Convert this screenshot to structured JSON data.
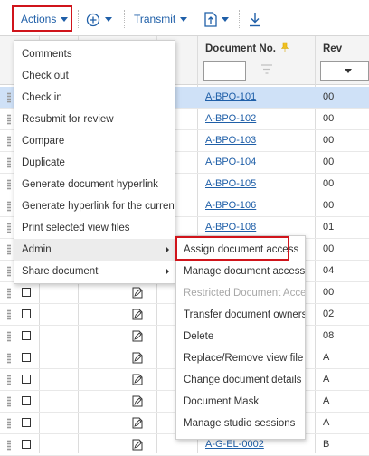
{
  "toolbar": {
    "actions_label": "Actions",
    "transmit_label": "Transmit"
  },
  "columns": {
    "document_no": "Document No.",
    "rev": "Rev"
  },
  "rows": [
    {
      "doc": "A-BPO-101",
      "rev": "00",
      "selected": true
    },
    {
      "doc": "A-BPO-102",
      "rev": "00"
    },
    {
      "doc": "A-BPO-103",
      "rev": "00"
    },
    {
      "doc": "A-BPO-104",
      "rev": "00"
    },
    {
      "doc": "A-BPO-105",
      "rev": "00"
    },
    {
      "doc": "A-BPO-106",
      "rev": "00"
    },
    {
      "doc": "A-BPO-108",
      "rev": "01"
    },
    {
      "doc": "",
      "rev": "00"
    },
    {
      "doc": "",
      "rev": "04"
    },
    {
      "doc": "",
      "rev": "00"
    },
    {
      "doc": "",
      "rev": "02"
    },
    {
      "doc": "",
      "rev": "08"
    },
    {
      "doc": "",
      "rev": "A"
    },
    {
      "doc": "",
      "rev": "A"
    },
    {
      "doc": "",
      "rev": "A"
    },
    {
      "doc": "",
      "rev": "A"
    },
    {
      "doc": "A-G-EL-0002",
      "rev": "B"
    }
  ],
  "actions_menu": [
    "Comments",
    "Check out",
    "Check in",
    "Resubmit for review",
    "Compare",
    "Duplicate",
    "Generate document hyperlink",
    "Generate hyperlink for the current r...",
    "Print selected view files",
    "Admin",
    "Share document"
  ],
  "admin_submenu": [
    {
      "label": "Assign document access",
      "disabled": false
    },
    {
      "label": "Manage document access",
      "disabled": false
    },
    {
      "label": "Restricted Document Access",
      "disabled": true
    },
    {
      "label": "Transfer document ownership",
      "disabled": false
    },
    {
      "label": "Delete",
      "disabled": false
    },
    {
      "label": "Replace/Remove view file",
      "disabled": false
    },
    {
      "label": "Change document details",
      "disabled": false
    },
    {
      "label": "Document Mask",
      "disabled": false
    },
    {
      "label": "Manage studio sessions",
      "disabled": false
    }
  ],
  "colors": {
    "link": "#1f5fa8",
    "highlight_box": "#d0141b",
    "selected_row": "#cfe1f7"
  },
  "icons": [
    "caret-down-icon",
    "add-circle-icon",
    "transmit-icon",
    "export-icon",
    "download-icon",
    "sort-pin-icon",
    "filter-icon",
    "edit-document-icon",
    "drag-handle-icon",
    "submenu-arrow-icon"
  ]
}
